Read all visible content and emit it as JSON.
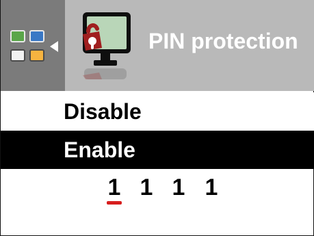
{
  "header": {
    "title": "PIN protection",
    "icons": {
      "back": "back-arrow-icon",
      "sources": [
        "input-icon-tl",
        "input-icon-tr",
        "input-icon-bl",
        "input-icon-br"
      ],
      "monitor_lock": "monitor-lock-icon"
    }
  },
  "menu": {
    "items": [
      {
        "label": "Disable",
        "selected": false
      },
      {
        "label": "Enable",
        "selected": true
      }
    ]
  },
  "pin": {
    "digits": [
      "1",
      "1",
      "1",
      "1"
    ],
    "active_index": 0
  },
  "colors": {
    "header_bg": "#b9b9b9",
    "left_panel_bg": "#7b7b7b",
    "selected_bg": "#000000",
    "selected_text": "#ffffff",
    "cursor": "#d71e1e",
    "lock_red": "#a01f1f",
    "monitor_screen": "#b9d6b8"
  }
}
